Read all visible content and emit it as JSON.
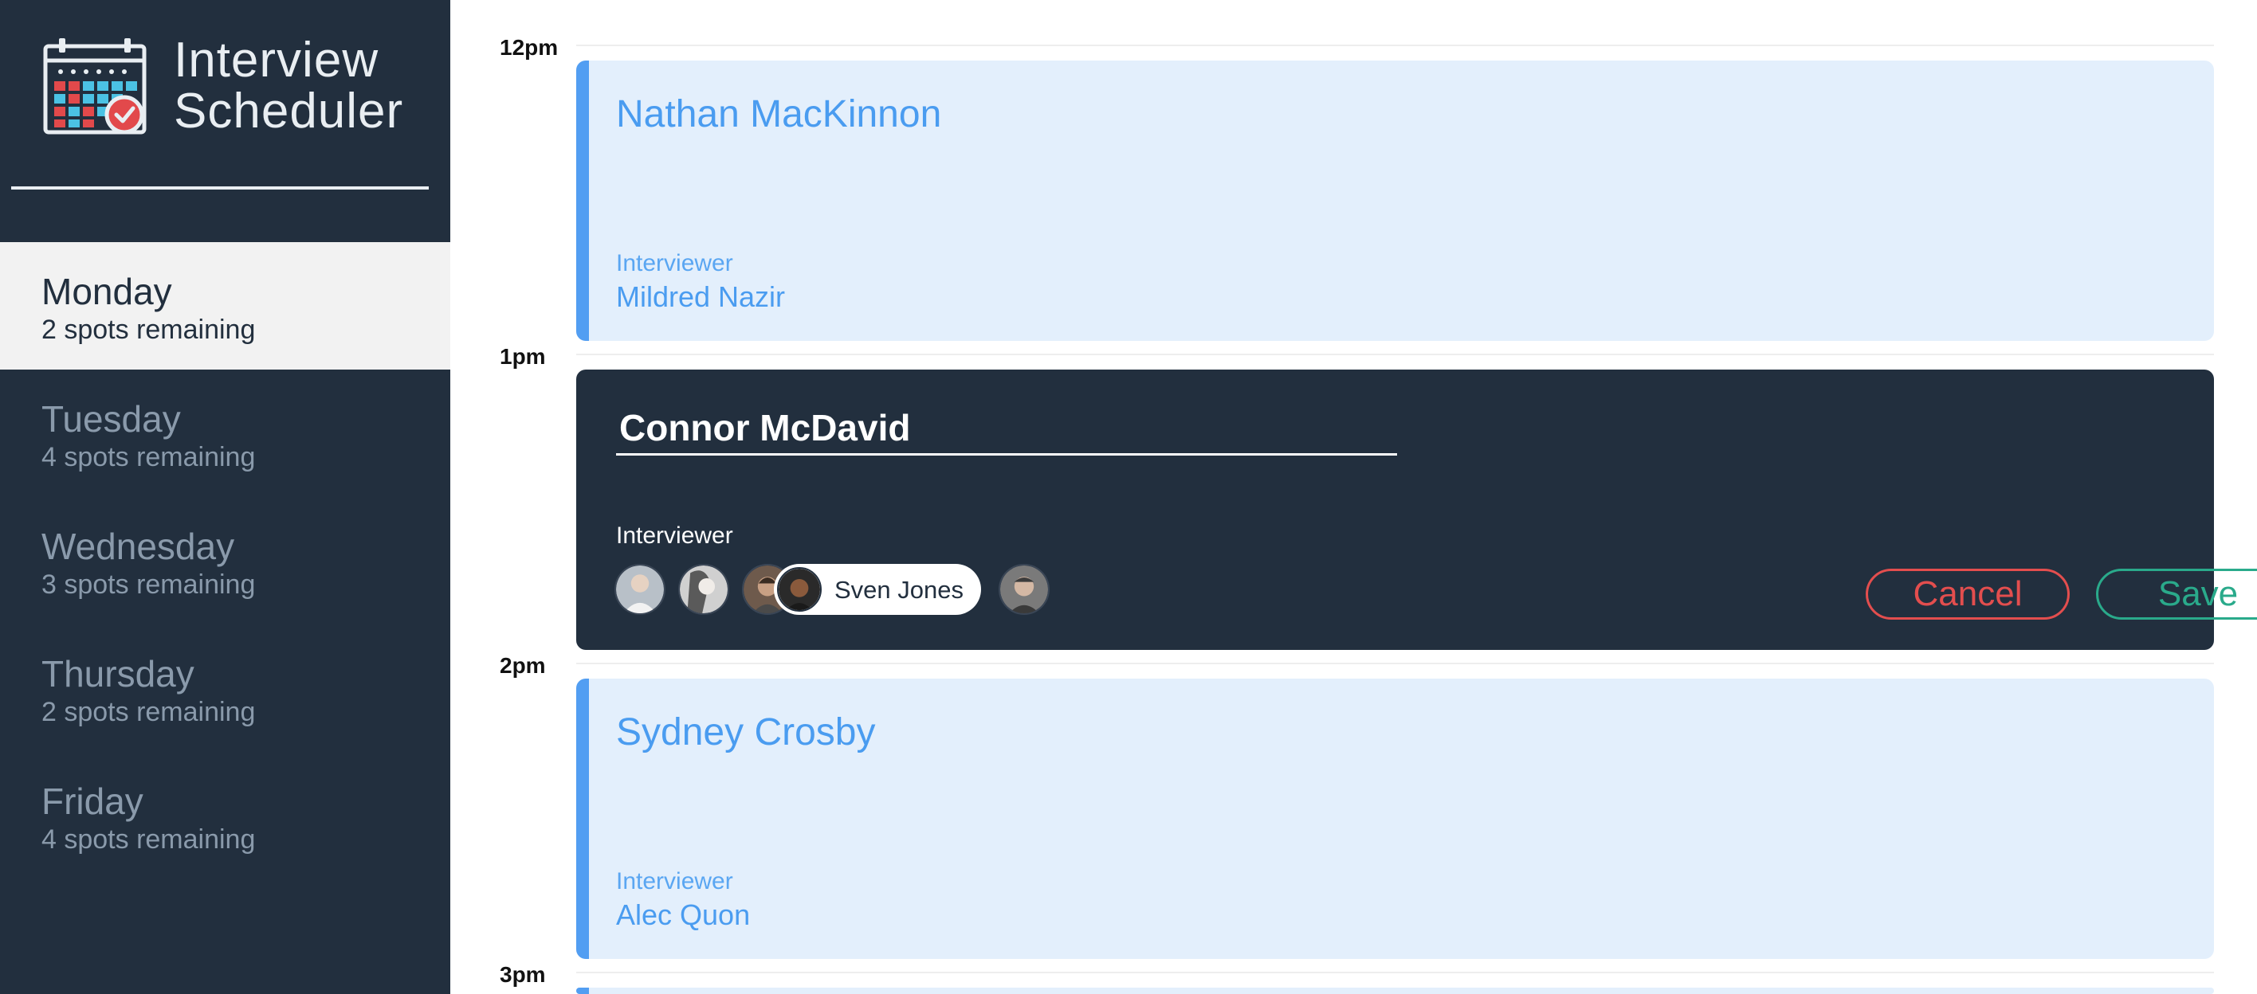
{
  "app": {
    "title_line1": "Interview",
    "title_line2": "Scheduler",
    "logo_icon": "calendar-check-icon"
  },
  "days": [
    {
      "name": "Monday",
      "spots": "2 spots remaining",
      "selected": true
    },
    {
      "name": "Tuesday",
      "spots": "4 spots remaining",
      "selected": false
    },
    {
      "name": "Wednesday",
      "spots": "3 spots remaining",
      "selected": false
    },
    {
      "name": "Thursday",
      "spots": "2 spots remaining",
      "selected": false
    },
    {
      "name": "Friday",
      "spots": "4 spots remaining",
      "selected": false
    }
  ],
  "times": [
    "12pm",
    "1pm",
    "2pm",
    "3pm"
  ],
  "appointments": [
    {
      "student": "Nathan MacKinnon",
      "interviewer_label": "Interviewer",
      "interviewer": "Mildred Nazir"
    },
    {
      "student": "Sydney Crosby",
      "interviewer_label": "Interviewer",
      "interviewer": "Alec Quon"
    }
  ],
  "edit_form": {
    "student_value": "Connor McDavid",
    "interviewer_label": "Interviewer",
    "selected_interviewer": "Sven Jones",
    "cancel_label": "Cancel",
    "save_label": "Save"
  },
  "colors": {
    "sidebar": "#222f3e",
    "accent_blue": "#529ef2",
    "appointment_bg": "#e3effc",
    "cancel": "#e34e4e",
    "save": "#2aaa8b"
  }
}
